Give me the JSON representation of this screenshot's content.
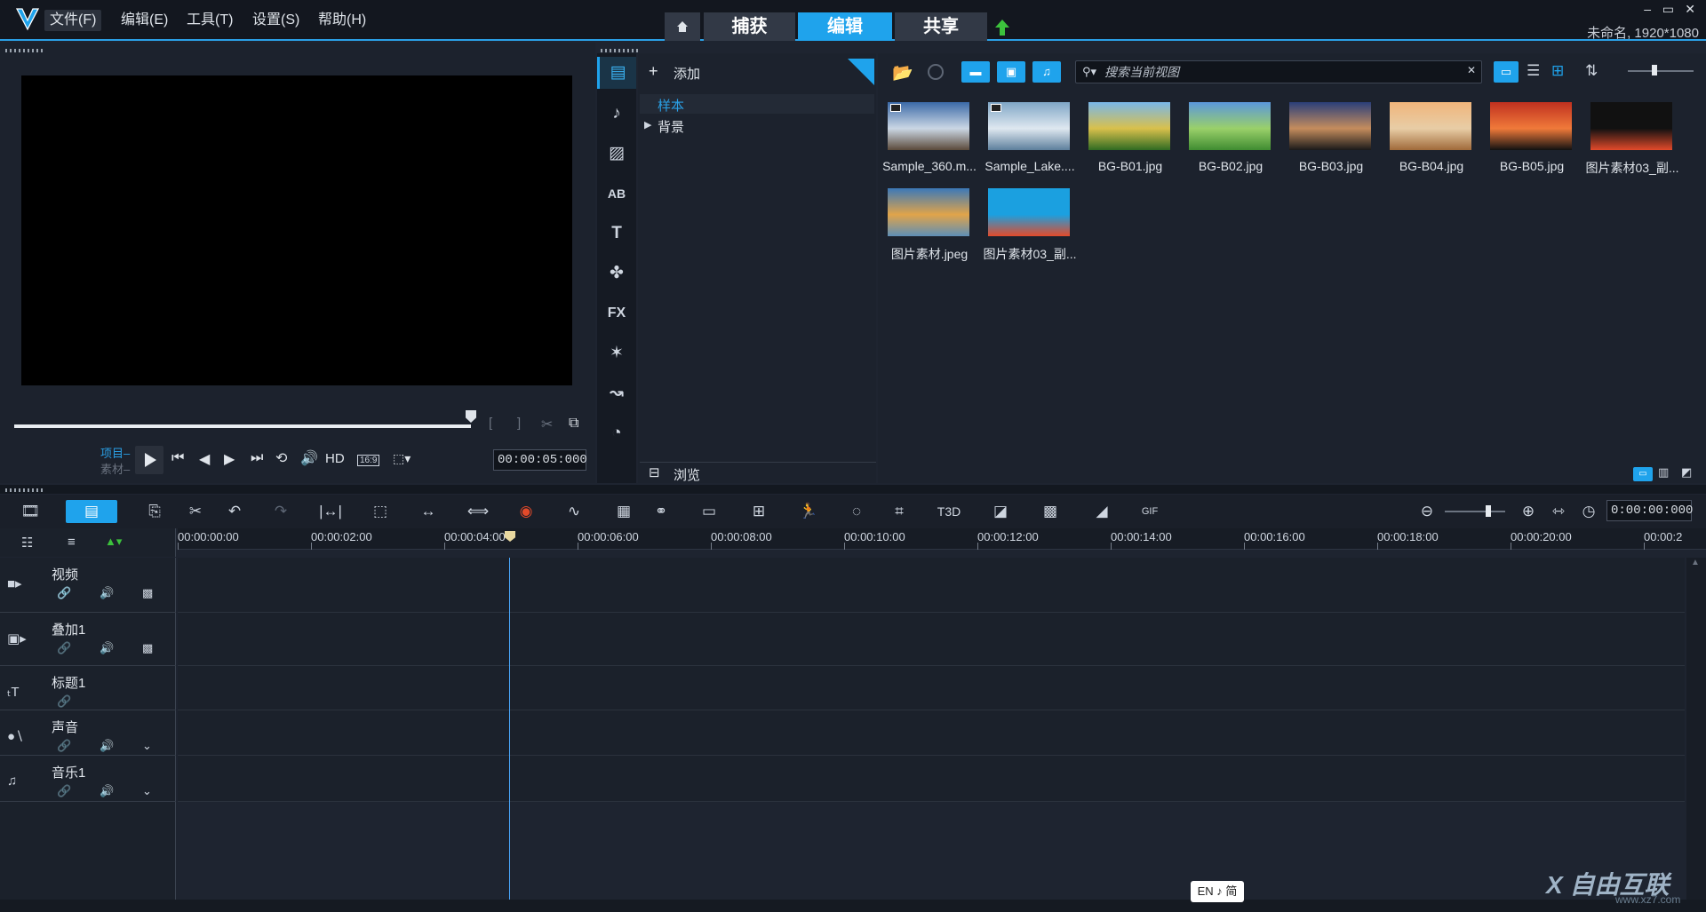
{
  "menu": {
    "file": "文件(F)",
    "edit": "编辑(E)",
    "tools": "工具(T)",
    "settings": "设置(S)",
    "help": "帮助(H)"
  },
  "tabs": {
    "home_icon": "home-icon",
    "capture": "捕获",
    "edit": "编辑",
    "share": "共享"
  },
  "window": {
    "project_info": "未命名, 1920*1080",
    "minimize": "–",
    "maximize": "▭",
    "close": "✕"
  },
  "preview": {
    "mode_project": "项目–",
    "mode_clip": "素材–",
    "quality": "HD",
    "aspect": "16:9",
    "timecode": "00:00:05:000"
  },
  "library": {
    "add_label": "添加",
    "folders": [
      {
        "label": "样本",
        "selected": true
      },
      {
        "label": "背景",
        "selected": false
      }
    ],
    "browse_label": "浏览",
    "search_placeholder": "搜索当前视图",
    "thumbnails": [
      {
        "caption": "Sample_360.m...",
        "kind": "video",
        "colors": [
          "#3b6aa8",
          "#cbd7e4",
          "#5b4a3a"
        ]
      },
      {
        "caption": "Sample_Lake....",
        "kind": "video",
        "colors": [
          "#7fa6c6",
          "#dfe8f0",
          "#5d7f9c"
        ]
      },
      {
        "caption": "BG-B01.jpg",
        "kind": "image",
        "colors": [
          "#79b7ea",
          "#d9c04c",
          "#2f6b22"
        ]
      },
      {
        "caption": "BG-B02.jpg",
        "kind": "image",
        "colors": [
          "#5b97dc",
          "#9ad06a",
          "#3f8c31"
        ]
      },
      {
        "caption": "BG-B03.jpg",
        "kind": "image",
        "colors": [
          "#2a3f7a",
          "#c58d5d",
          "#1a1a1a"
        ]
      },
      {
        "caption": "BG-B04.jpg",
        "kind": "image",
        "colors": [
          "#f0b57b",
          "#e8cda6",
          "#a06a3a"
        ]
      },
      {
        "caption": "BG-B05.jpg",
        "kind": "image",
        "colors": [
          "#c0301f",
          "#f07a3a",
          "#111111"
        ]
      },
      {
        "caption": "图片素材03_副...",
        "kind": "image",
        "colors": [
          "#111111",
          "#111111",
          "#e24a2a"
        ]
      },
      {
        "caption": "图片素材.jpeg",
        "kind": "image",
        "colors": [
          "#3b78b8",
          "#e0a44a",
          "#5e8fb6"
        ]
      },
      {
        "caption": "图片素材03_副...",
        "kind": "image",
        "colors": [
          "#1ba0e0",
          "#1ba0e0",
          "#e24a2a"
        ]
      }
    ]
  },
  "timeline": {
    "timecode": "0:00:00:000",
    "ruler": [
      "00:00:00:00",
      "00:00:02:00",
      "00:00:04:00",
      "00:00:06:00",
      "00:00:08:00",
      "00:00:10:00",
      "00:00:12:00",
      "00:00:14:00",
      "00:00:16:00",
      "00:00:18:00",
      "00:00:20:00",
      "00:00:2"
    ],
    "tracks": [
      {
        "name": "视频",
        "icon": "video-camera-icon"
      },
      {
        "name": "叠加1",
        "icon": "overlay-icon"
      },
      {
        "name": "标题1",
        "icon": "title-icon"
      },
      {
        "name": "声音",
        "icon": "voice-icon"
      },
      {
        "name": "音乐1",
        "icon": "music-icon"
      }
    ]
  },
  "ime": "EN ♪ 简",
  "watermark": {
    "main": "X 自由互联",
    "sub": "www.xz7.com"
  }
}
